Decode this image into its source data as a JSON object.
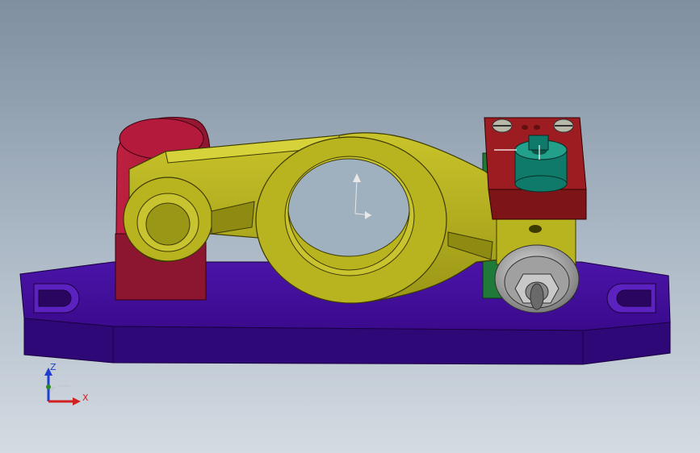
{
  "window": {
    "type": "3d-cad-graphics-viewport",
    "background_top": "#7f8fa0",
    "background_bottom": "#d4dbe2"
  },
  "model": {
    "parts": [
      {
        "name": "base-plate",
        "color": "#3a0a8c"
      },
      {
        "name": "support-bracket",
        "color": "#9b1b3a"
      },
      {
        "name": "rocker-arm",
        "color": "#b6b21e"
      },
      {
        "name": "block",
        "color": "#8c1c1c"
      },
      {
        "name": "knob",
        "color": "#0f7a6a"
      },
      {
        "name": "nut-assembly",
        "color": "#a8a8a8"
      },
      {
        "name": "green-part",
        "color": "#1f7a3a"
      }
    ]
  },
  "triad": {
    "z_label": "Z",
    "x_label": "X",
    "z_color": "#1f3fd0",
    "x_color": "#d02020",
    "y_color": "#2a8a2a"
  }
}
